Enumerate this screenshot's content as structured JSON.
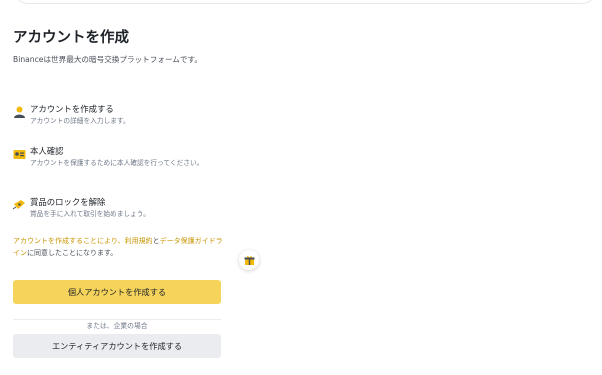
{
  "title": "アカウントを作成",
  "description": "Binanceは世界最大の暗号交換プラットフォームです。",
  "steps": [
    {
      "title": "アカウントを作成する",
      "desc": "アカウントの詳細を入力します。",
      "icon": "person-icon"
    },
    {
      "title": "本人確認",
      "desc": "アカウントを保護するために本人確認を行ってください。",
      "icon": "id-card-icon"
    },
    {
      "title": "賞品のロックを解除",
      "desc": "賞品を手に入れて取引を始めましょう。",
      "icon": "ticket-icon"
    }
  ],
  "terms": {
    "link1": "アカウントを作成することにより、利用規約",
    "middle": "と",
    "link2": "データ保護ガイドライン",
    "suffix": "に同意したことになります。"
  },
  "buttons": {
    "personal": "個人アカウントを作成する",
    "or": "または、企業の場合",
    "entity": "エンティティアカウントを作成する"
  },
  "colors": {
    "accent": "#f6d35a",
    "link": "#c99400",
    "secondary": "#eaecef"
  }
}
